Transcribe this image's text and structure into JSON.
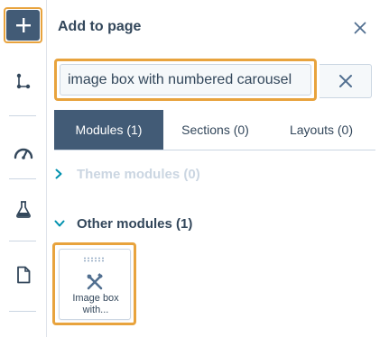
{
  "colors": {
    "accent_highlight": "#e8a33d",
    "primary_dark": "#425b76",
    "text": "#33475b",
    "muted_text": "#cbd6e2",
    "teal": "#0091ae",
    "border": "#cbd6e2"
  },
  "rail": {
    "items": [
      {
        "icon": "plus-icon"
      },
      {
        "icon": "tree-structure-icon"
      },
      {
        "icon": "speedometer-icon"
      },
      {
        "icon": "flask-icon"
      },
      {
        "icon": "document-icon"
      }
    ]
  },
  "panel": {
    "title": "Add to page",
    "close_icon": "close-icon"
  },
  "search": {
    "value": "image box with numbered carousel",
    "clear_icon": "close-icon"
  },
  "tabs": [
    {
      "label": "Modules (1)",
      "active": true
    },
    {
      "label": "Sections (0)",
      "active": false
    },
    {
      "label": "Layouts (0)",
      "active": false
    }
  ],
  "sections": {
    "theme": {
      "label": "Theme modules (0)",
      "expanded": false,
      "icon": "chevron-right-icon"
    },
    "other": {
      "label": "Other modules (1)",
      "expanded": true,
      "icon": "chevron-down-icon"
    }
  },
  "modules": [
    {
      "label": "Image box with...",
      "icon": "tools-icon",
      "handle_icon": "drag-handle-icon"
    }
  ]
}
